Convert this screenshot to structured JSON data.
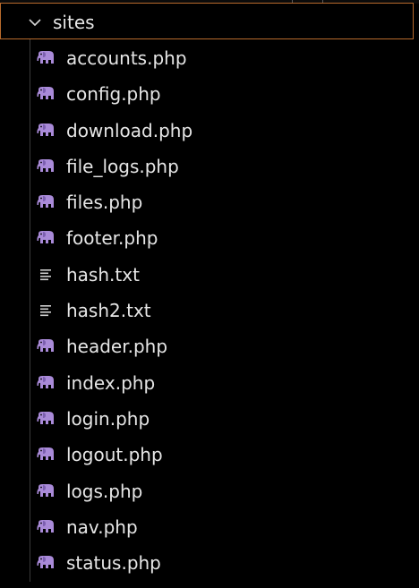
{
  "explorer": {
    "folder": {
      "name": "sites",
      "expanded": true
    },
    "colors": {
      "background": "#000000",
      "focus_border": "#b86a2c",
      "php_icon": "#a98ad8",
      "text_icon": "#cfcfcf",
      "text": "#e6e6e6"
    },
    "files": [
      {
        "name": "accounts.php",
        "icon": "php-elephant-icon"
      },
      {
        "name": "config.php",
        "icon": "php-elephant-icon"
      },
      {
        "name": "download.php",
        "icon": "php-elephant-icon"
      },
      {
        "name": "file_logs.php",
        "icon": "php-elephant-icon"
      },
      {
        "name": "files.php",
        "icon": "php-elephant-icon"
      },
      {
        "name": "footer.php",
        "icon": "php-elephant-icon"
      },
      {
        "name": "hash.txt",
        "icon": "text-file-icon"
      },
      {
        "name": "hash2.txt",
        "icon": "text-file-icon"
      },
      {
        "name": "header.php",
        "icon": "php-elephant-icon"
      },
      {
        "name": "index.php",
        "icon": "php-elephant-icon"
      },
      {
        "name": "login.php",
        "icon": "php-elephant-icon"
      },
      {
        "name": "logout.php",
        "icon": "php-elephant-icon"
      },
      {
        "name": "logs.php",
        "icon": "php-elephant-icon"
      },
      {
        "name": "nav.php",
        "icon": "php-elephant-icon"
      },
      {
        "name": "status.php",
        "icon": "php-elephant-icon"
      }
    ]
  }
}
